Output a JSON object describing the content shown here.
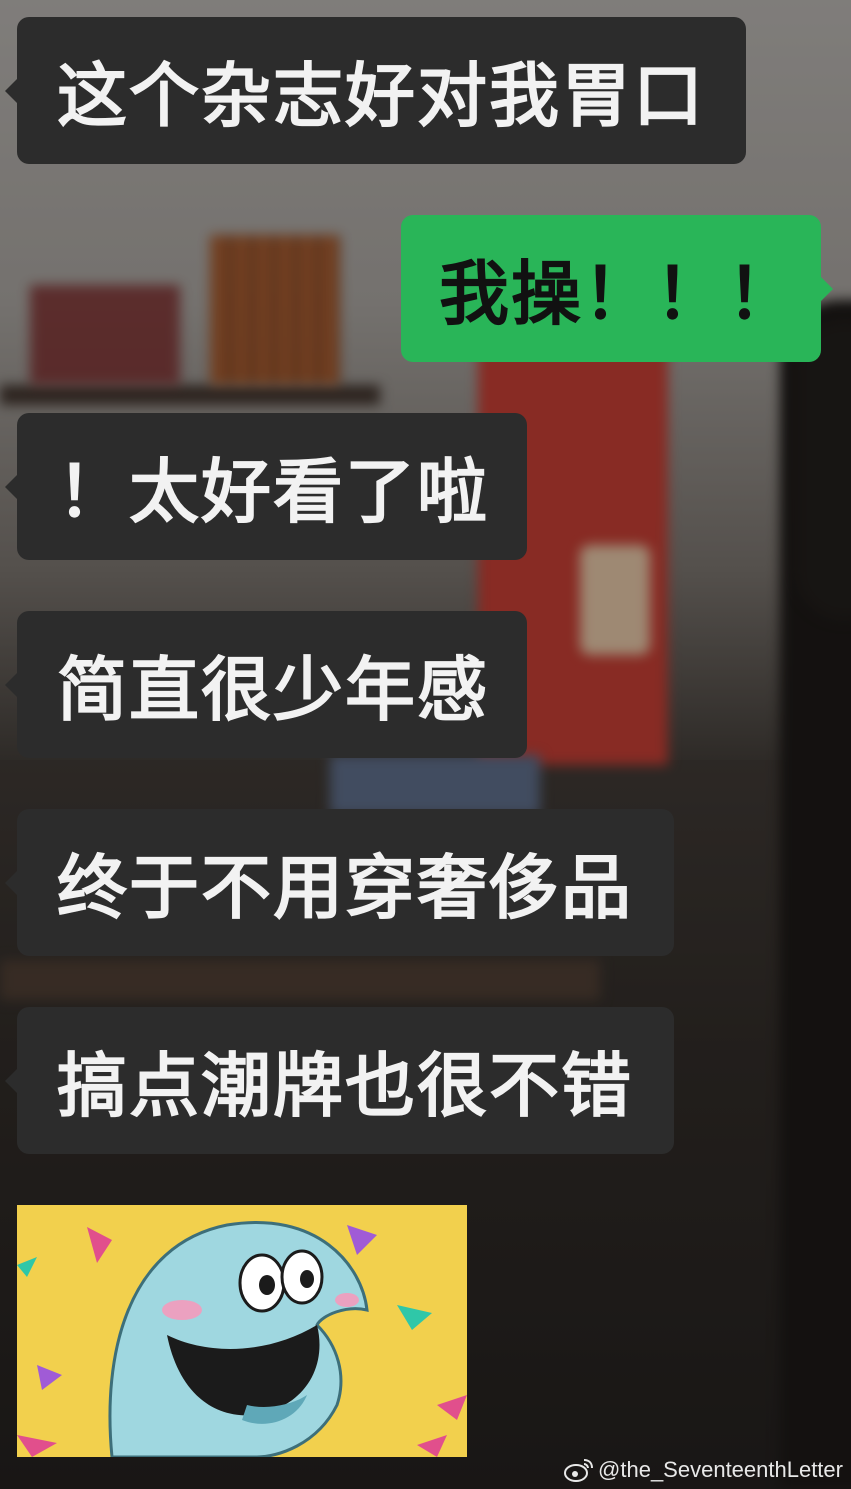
{
  "messages": [
    {
      "side": "left",
      "text": "这个杂志好对我胃口"
    },
    {
      "side": "right",
      "text": "我操！！！"
    },
    {
      "side": "left",
      "text": "！太好看了啦"
    },
    {
      "side": "left",
      "text": "简直很少年感"
    },
    {
      "side": "left",
      "text": "终于不用穿奢侈品"
    },
    {
      "side": "left",
      "text": "搞点潮牌也很不错"
    }
  ],
  "sticker": {
    "icon": "smiling-blue-creature-sticker"
  },
  "watermark": {
    "text": "@the_SeventeenthLetter",
    "icon": "weibo-logo-icon"
  },
  "colors": {
    "incoming_bubble": "#2c2c2c",
    "outgoing_bubble": "#29b558",
    "sticker_bg": "#f2d04d"
  }
}
